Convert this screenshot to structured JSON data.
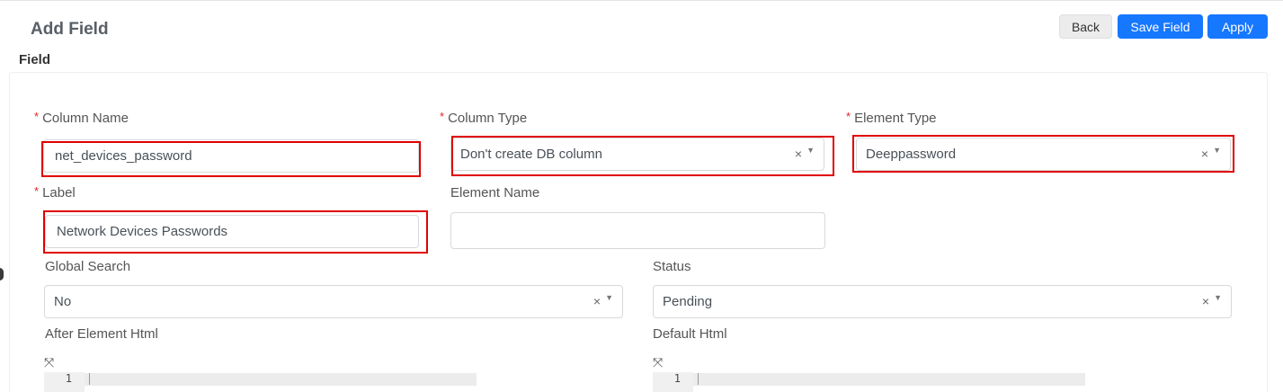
{
  "header": {
    "title": "Add Field",
    "section": "Field",
    "back_label": "Back",
    "save_label": "Save Field",
    "apply_label": "Apply"
  },
  "form": {
    "required_mark": "*",
    "column_name": {
      "label": "Column Name",
      "value": "net_devices_password"
    },
    "column_type": {
      "label": "Column Type",
      "value": "Don't create DB column"
    },
    "element_type": {
      "label": "Element Type",
      "value": "Deeppassword"
    },
    "label": {
      "label": "Label",
      "value": "Network Devices Passwords"
    },
    "element_name": {
      "label": "Element Name",
      "value": ""
    },
    "global_search": {
      "label": "Global Search",
      "value": "No"
    },
    "status": {
      "label": "Status",
      "value": "Pending"
    },
    "after_element_html": {
      "label": "After Element Html",
      "line_number": "1"
    },
    "default_html": {
      "label": "Default Html",
      "line_number": "1"
    },
    "clear_glyph": "×",
    "arrow_glyph": "▼",
    "expand_glyph": "⤧"
  },
  "colors": {
    "primary": "#1677ff",
    "highlight": "#e00000",
    "required": "#e02424"
  }
}
